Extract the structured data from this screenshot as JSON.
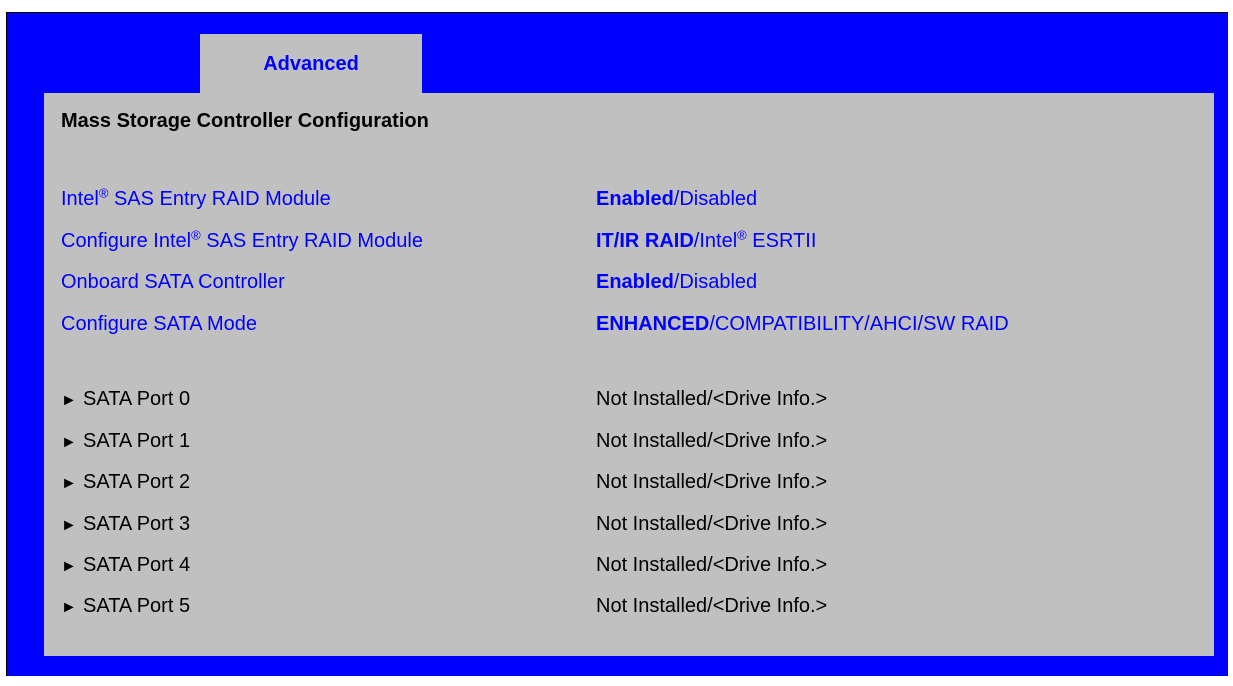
{
  "tab": {
    "label": "Advanced"
  },
  "page_title": "Mass Storage Controller Configuration",
  "settings": [
    {
      "label_pre": "Intel",
      "label_reg": "®",
      "label_post": " SAS Entry RAID Module",
      "selected": "Enabled",
      "rest_pre": "/Disabled",
      "rest_reg": "",
      "rest_post": ""
    },
    {
      "label_pre": "Configure Intel",
      "label_reg": "®",
      "label_post": " SAS Entry RAID Module",
      "selected": "IT/IR RAID",
      "rest_pre": "/Intel",
      "rest_reg": "®",
      "rest_post": " ESRTII"
    },
    {
      "label_pre": "Onboard SATA Controller",
      "label_reg": "",
      "label_post": "",
      "selected": "Enabled",
      "rest_pre": "/Disabled",
      "rest_reg": "",
      "rest_post": ""
    },
    {
      "label_pre": "Configure SATA Mode",
      "label_reg": "",
      "label_post": "",
      "selected": "ENHANCED",
      "rest_pre": "/COMPATIBILITY/AHCI/SW RAID",
      "rest_reg": "",
      "rest_post": ""
    }
  ],
  "submenu_marker": "►",
  "ports": [
    {
      "label": "SATA Port 0",
      "value": "Not Installed/<Drive Info.>"
    },
    {
      "label": "SATA Port 1",
      "value": "Not Installed/<Drive Info.>"
    },
    {
      "label": "SATA Port 2",
      "value": "Not Installed/<Drive Info.>"
    },
    {
      "label": "SATA Port 3",
      "value": "Not Installed/<Drive Info.>"
    },
    {
      "label": "SATA Port 4",
      "value": "Not Installed/<Drive Info.>"
    },
    {
      "label": "SATA Port 5",
      "value": "Not Installed/<Drive Info.>"
    }
  ]
}
